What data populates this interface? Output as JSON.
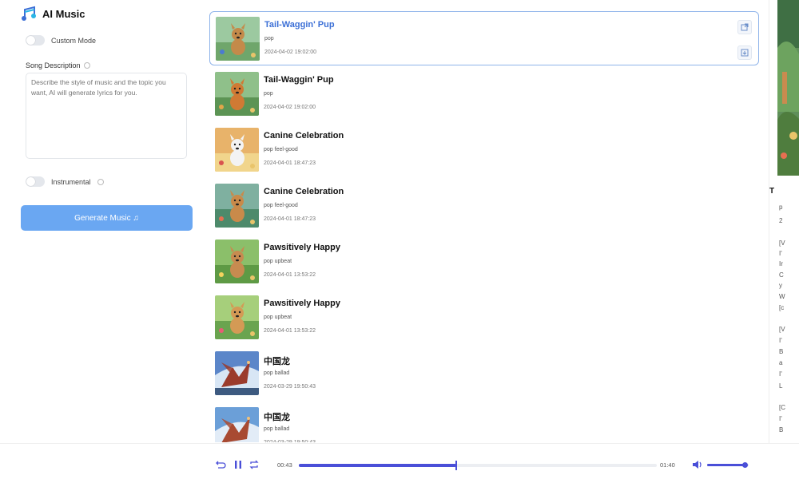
{
  "app": {
    "title": "AI Music"
  },
  "form": {
    "custom_mode_label": "Custom Mode",
    "custom_mode_on": false,
    "song_description_label": "Song Description",
    "song_description_placeholder": "Describe the style of music and the topic you want, AI will generate lyrics for you.",
    "instrumental_label": "Instrumental",
    "instrumental_on": false,
    "generate_label": "Generate Music ♫"
  },
  "songs": [
    {
      "title": "Tail-Waggin' Pup",
      "tags": "pop",
      "date": "2024-04-02 19:02:00",
      "active": true,
      "art": "dog-blue"
    },
    {
      "title": "Tail-Waggin' Pup",
      "tags": "pop",
      "date": "2024-04-02 19:02:00",
      "active": false,
      "art": "dog-orange"
    },
    {
      "title": "Canine Celebration",
      "tags": "pop feel-good",
      "date": "2024-04-01 18:47:23",
      "active": false,
      "art": "dog-white"
    },
    {
      "title": "Canine Celebration",
      "tags": "pop feel-good",
      "date": "2024-04-01 18:47:23",
      "active": false,
      "art": "dog-lake"
    },
    {
      "title": "Pawsitively Happy",
      "tags": "pop upbeat",
      "date": "2024-04-01 13:53:22",
      "active": false,
      "art": "dog-forest"
    },
    {
      "title": "Pawsitively Happy",
      "tags": "pop upbeat",
      "date": "2024-04-01 13:53:22",
      "active": false,
      "art": "dog-garden"
    },
    {
      "title": "中国龙",
      "tags": "pop ballad",
      "date": "2024-03-29 19:50:43",
      "active": false,
      "art": "dragon-red"
    },
    {
      "title": "中国龙",
      "tags": "pop ballad",
      "date": "2024-03-29 19:50:43",
      "active": false,
      "art": "dragon-blue"
    }
  ],
  "right_panel": {
    "title_fragment": "T",
    "lines": [
      "p",
      "2",
      "[V",
      "I'",
      "Ir",
      "C",
      "y",
      "W",
      "[c",
      "[V",
      "I'",
      "B",
      "a",
      "I'",
      "L",
      "[C",
      "I'",
      "B"
    ]
  },
  "player": {
    "current_time": "00:43",
    "duration": "01:40",
    "progress_fraction": 0.44,
    "volume_fraction": 0.9
  },
  "colors": {
    "accent": "#4a4fd8",
    "active_title": "#3b6fd6",
    "generate_button": "#6aa7f2"
  }
}
